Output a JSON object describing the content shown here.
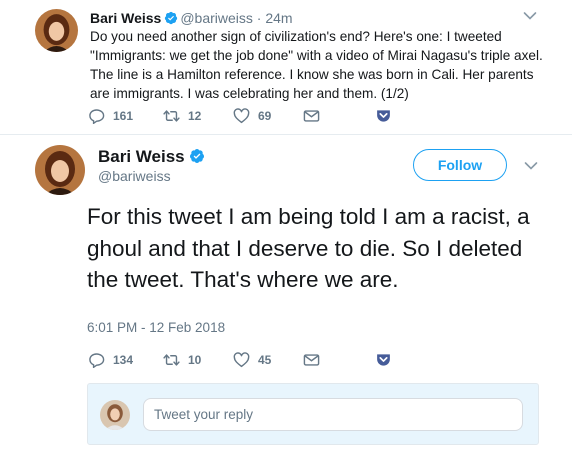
{
  "colors": {
    "accent": "#1da1f2",
    "muted": "#657786",
    "text": "#14171a",
    "reply_bg": "#e8f5fd"
  },
  "tweet1": {
    "name": "Bari Weiss",
    "handle": "@bariweiss",
    "time": " · 24m",
    "text": "Do you need another sign of civilization's end? Here's one: I tweeted \"Immigrants: we get the job done\" with a video of Mirai Nagasu's triple axel. The line is a Hamilton reference. I know she was born in Cali. Her parents are immigrants. I was celebrating her and them. (1/2)",
    "replies": "161",
    "retweets": "12",
    "likes": "69"
  },
  "tweet2": {
    "name": "Bari Weiss",
    "handle": "@bariweiss",
    "follow_label": "Follow",
    "text": "For this tweet I am being told I am a racist, a ghoul and that I deserve to die. So I deleted the tweet. That's where we are.",
    "date": "6:01 PM - 12 Feb 2018",
    "replies": "134",
    "retweets": "10",
    "likes": "45"
  },
  "reply": {
    "placeholder": "Tweet your reply"
  }
}
